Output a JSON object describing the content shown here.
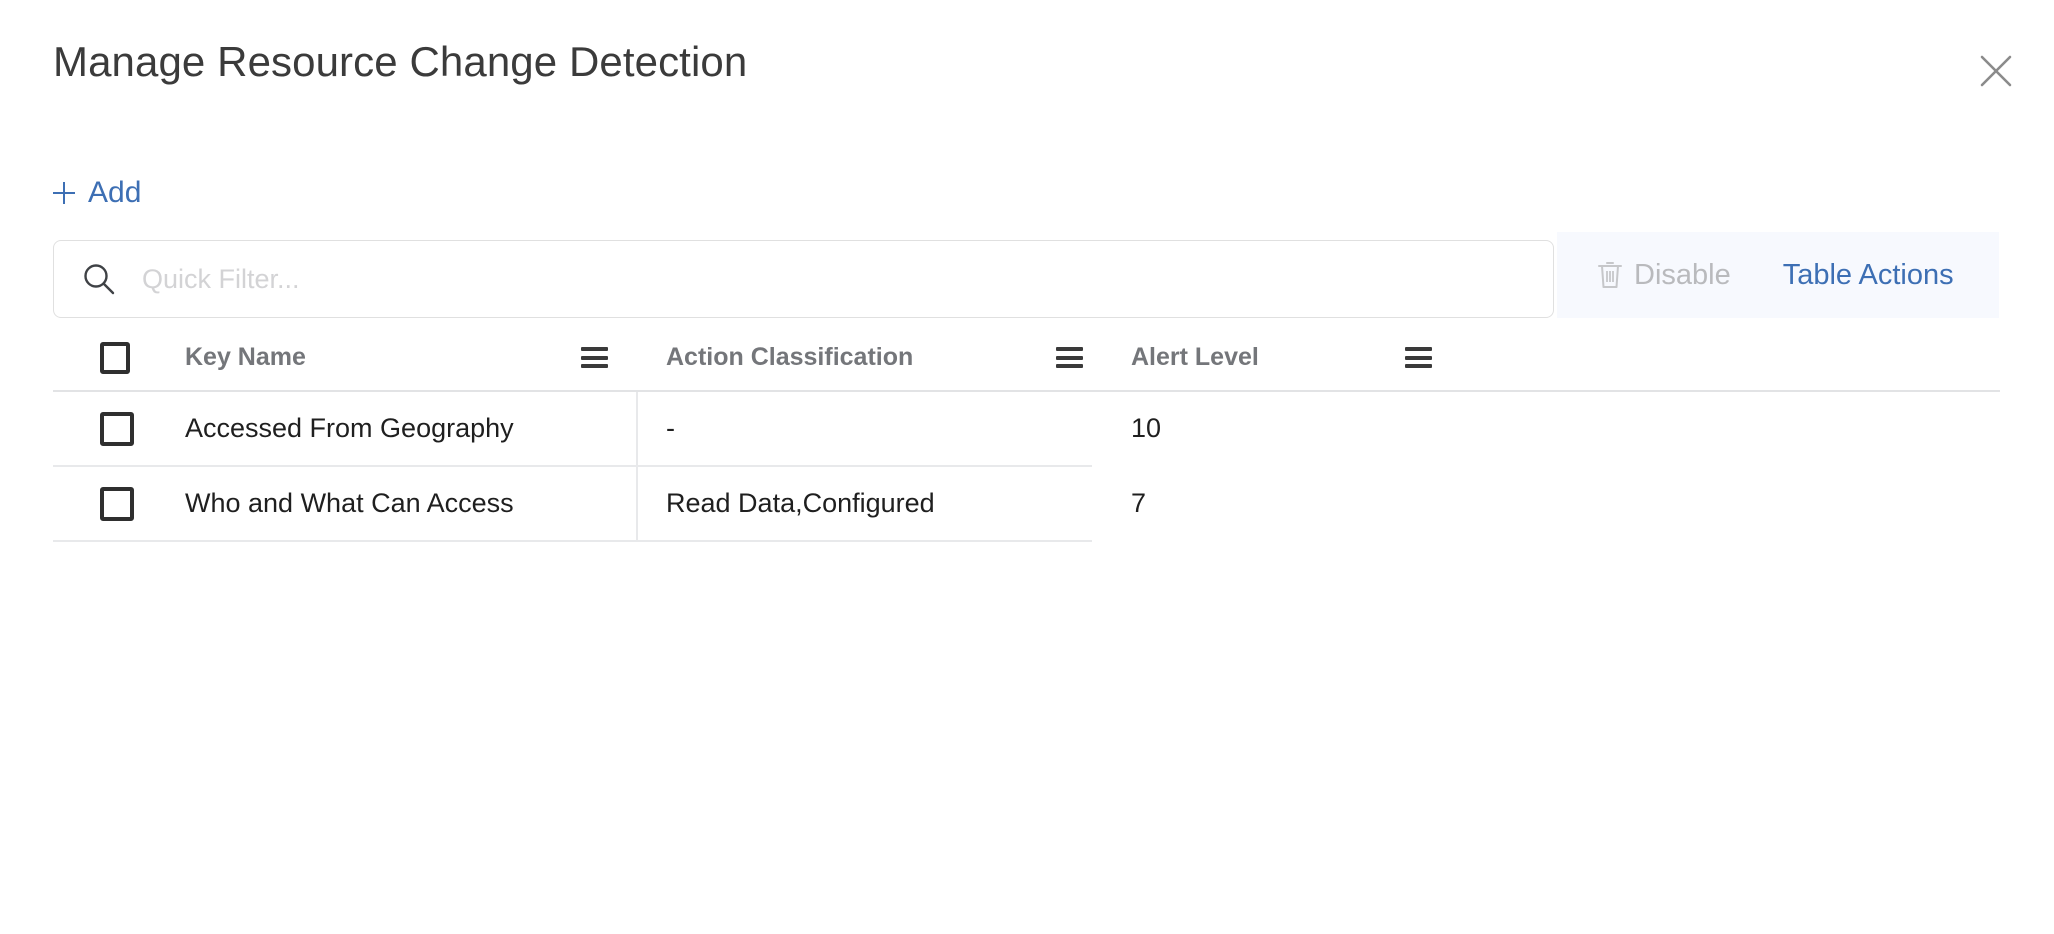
{
  "dialog": {
    "title": "Manage Resource Change Detection",
    "close_icon": "close-icon"
  },
  "actions": {
    "add_label": "Add",
    "add_icon": "plus-icon"
  },
  "search": {
    "placeholder": "Quick Filter...",
    "value": "",
    "icon": "search-icon"
  },
  "toolbar": {
    "disable_label": "Disable",
    "disable_icon": "trash-icon",
    "disable_enabled": false,
    "table_actions_label": "Table Actions"
  },
  "table": {
    "columns": [
      {
        "label": "Key Name",
        "menu_icon": "hamburger-icon"
      },
      {
        "label": "Action Classification",
        "menu_icon": "hamburger-icon"
      },
      {
        "label": "Alert Level",
        "menu_icon": "hamburger-icon"
      }
    ],
    "rows": [
      {
        "selected": false,
        "key_name": "Accessed From Geography",
        "action_classification": "-",
        "alert_level": "10"
      },
      {
        "selected": false,
        "key_name": "Who and What Can Access",
        "action_classification": "Read Data,Configured",
        "alert_level": "7"
      }
    ]
  },
  "colors": {
    "link": "#3d6fb4",
    "disabled_text": "#b9babd",
    "header_text": "#74767a",
    "strip_background": "#f7f9fe",
    "border": "#e8e9eb"
  }
}
